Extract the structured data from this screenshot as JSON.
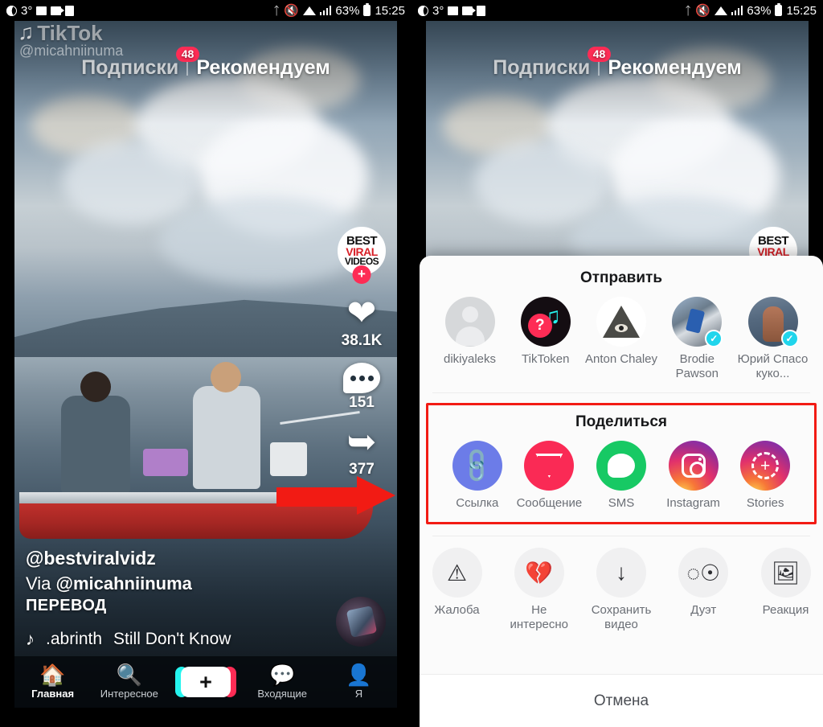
{
  "status_bar": {
    "temperature": "3°",
    "battery": "63%",
    "time": "15:25",
    "icons": [
      "moon-icon",
      "photo-icon",
      "video-camera-icon",
      "vibrate-icon",
      "bluetooth-icon",
      "mute-icon",
      "wifi-icon",
      "signal-icon",
      "battery-icon"
    ]
  },
  "video": {
    "watermark_logo": "TikTok",
    "watermark_user": "@micahniinuma",
    "tabs": {
      "following": "Подписки",
      "following_badge": "48",
      "for_you": "Рекомендуем"
    },
    "actions": {
      "avatar_line1": "BEST",
      "avatar_line2": "VIRAL",
      "avatar_line3": "VIDEOS",
      "follow_plus": "+",
      "likes": "38.1K",
      "comments": "151",
      "shares": "377"
    },
    "caption": {
      "username": "@bestviralvidz",
      "via_prefix": "Via ",
      "via_user": "@micahniinuma",
      "translate": "ПЕРЕВОД",
      "music_author": ".abrinth",
      "music_title": "Still Don't Know"
    }
  },
  "bottom_nav": {
    "items": [
      {
        "label": "Главная",
        "icon": "home-icon",
        "active": true
      },
      {
        "label": "Интересное",
        "icon": "search-icon",
        "active": false
      },
      {
        "label": "",
        "icon": "plus-icon",
        "active": false
      },
      {
        "label": "Входящие",
        "icon": "inbox-icon",
        "active": false
      },
      {
        "label": "Я",
        "icon": "profile-icon",
        "active": false
      }
    ],
    "add_label": "+"
  },
  "share_sheet": {
    "send_title": "Отправить",
    "contacts": [
      {
        "name": "dikiyaleks",
        "avatar": "placeholder-avatar",
        "verified": false
      },
      {
        "name": "TikToken",
        "avatar": "tiktoken-avatar",
        "verified": false
      },
      {
        "name": "Anton Chaley",
        "avatar": "eye-pyramid-avatar",
        "verified": false
      },
      {
        "name": "Brodie Pawson",
        "avatar": "photo-avatar",
        "verified": true
      },
      {
        "name": "Юрий Спасо куко...",
        "avatar": "photo-avatar",
        "verified": true
      }
    ],
    "share_title": "Поделиться",
    "share_targets": [
      {
        "label": "Ссылка",
        "icon": "link-icon",
        "color": "#6c7ce8"
      },
      {
        "label": "Сообщение",
        "icon": "direct-message-icon",
        "color": "#fa2a55"
      },
      {
        "label": "SMS",
        "icon": "sms-bubble-icon",
        "color": "#17c964"
      },
      {
        "label": "Instagram",
        "icon": "instagram-icon",
        "color": "#e1306c"
      },
      {
        "label": "Stories",
        "icon": "instagram-stories-icon",
        "color": "#a02d8f"
      }
    ],
    "actions": [
      {
        "label": "Жалоба",
        "icon": "warning-triangle-icon"
      },
      {
        "label": "Не интересно",
        "icon": "broken-heart-icon"
      },
      {
        "label": "Сохранить видео",
        "icon": "download-icon"
      },
      {
        "label": "Дуэт",
        "icon": "duet-circles-icon"
      },
      {
        "label": "Реакция",
        "icon": "reaction-icon"
      }
    ],
    "cancel": "Отмена",
    "highlight_color": "#f21b14"
  },
  "annotation": {
    "arrow_color": "#f21b14",
    "arrow_target": "share-button"
  }
}
